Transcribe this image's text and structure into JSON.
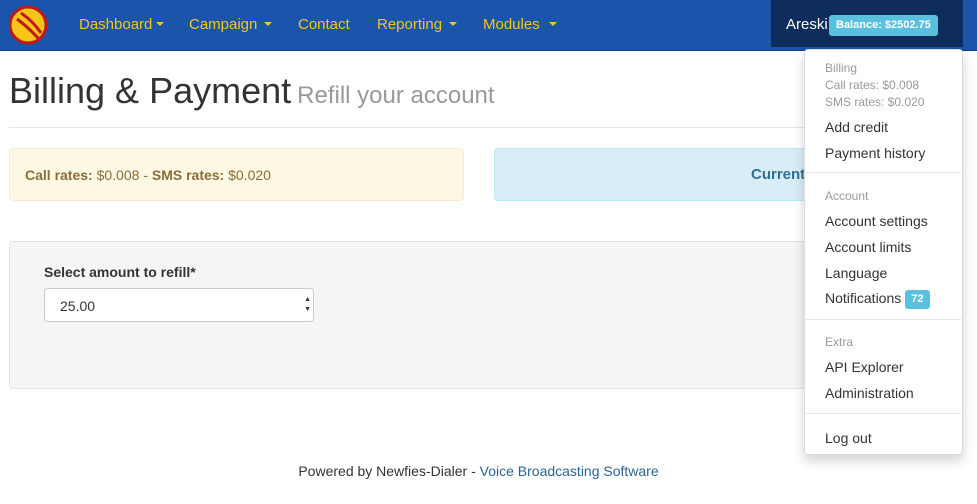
{
  "navbar": {
    "items": [
      {
        "label": "Dashboard"
      },
      {
        "label": "Campaign"
      },
      {
        "label": "Contact"
      },
      {
        "label": "Reporting"
      },
      {
        "label": "Modules"
      }
    ],
    "user": "Areski",
    "balance": "Balance: $2502.75"
  },
  "page": {
    "title": "Billing & Payment",
    "subtitle": "Refill your account"
  },
  "rates_alert": {
    "call_label": "Call rates:",
    "call_value": " $0.008 - ",
    "sms_label": "SMS rates:",
    "sms_value": " $0.020"
  },
  "info_alert": {
    "text": "Current"
  },
  "form": {
    "label": "Select amount to refill*",
    "selected": "25.00"
  },
  "footer": {
    "prefix": "Powered by Newfies-Dialer - ",
    "link": "Voice Broadcasting Software"
  },
  "dropdown": {
    "billing_header": "Billing",
    "call_rates": "Call rates: $0.008",
    "sms_rates": "SMS rates: $0.020",
    "add_credit": "Add credit",
    "payment_history": "Payment history",
    "account_header": "Account",
    "account_settings": "Account settings",
    "account_limits": "Account limits",
    "language": "Language",
    "notifications": "Notifications",
    "notifications_count": "72",
    "extra_header": "Extra",
    "api_explorer": "API Explorer",
    "administration": "Administration",
    "log_out": "Log out"
  },
  "colors": {
    "navbar": "#1b55ab",
    "nav_text": "#f5c518",
    "badge": "#5bc0de"
  }
}
